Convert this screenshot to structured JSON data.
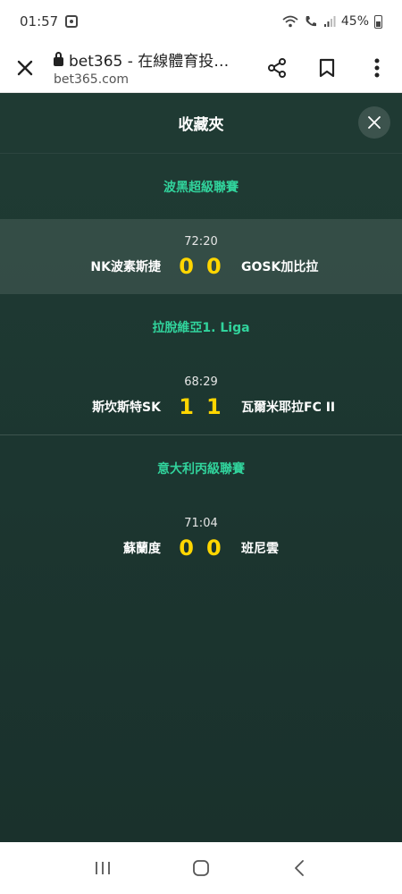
{
  "status_bar": {
    "time": "01:57",
    "battery": "45%"
  },
  "browser": {
    "title": "bet365 - 在線體育投…",
    "host": "bet365.com"
  },
  "favourites": {
    "title": "收藏夾",
    "groups": [
      {
        "league": "波黑超級聯賽",
        "match": {
          "time": "72:20",
          "home": "NK波素斯捷",
          "home_score": "0",
          "away_score": "0",
          "away": "GOSK加比拉"
        }
      },
      {
        "league": "拉脫維亞1. Liga",
        "match": {
          "time": "68:29",
          "home": "斯坎斯特SK",
          "home_score": "1",
          "away_score": "1",
          "away": "瓦爾米耶拉FC II"
        }
      },
      {
        "league": "意大利丙級聯賽",
        "match": {
          "time": "71:04",
          "home": "蘇蘭度",
          "home_score": "0",
          "away_score": "0",
          "away": "班尼雲"
        }
      }
    ]
  },
  "icons": {
    "close": "close-icon",
    "share": "share-icon",
    "bookmark": "bookmark-icon",
    "menu": "more-vert-icon",
    "recents": "recents-icon",
    "home": "home-icon",
    "back": "back-icon"
  },
  "colors": {
    "panel_bg": "#1f3a33",
    "league": "#31d39c",
    "score": "#ffd600"
  }
}
